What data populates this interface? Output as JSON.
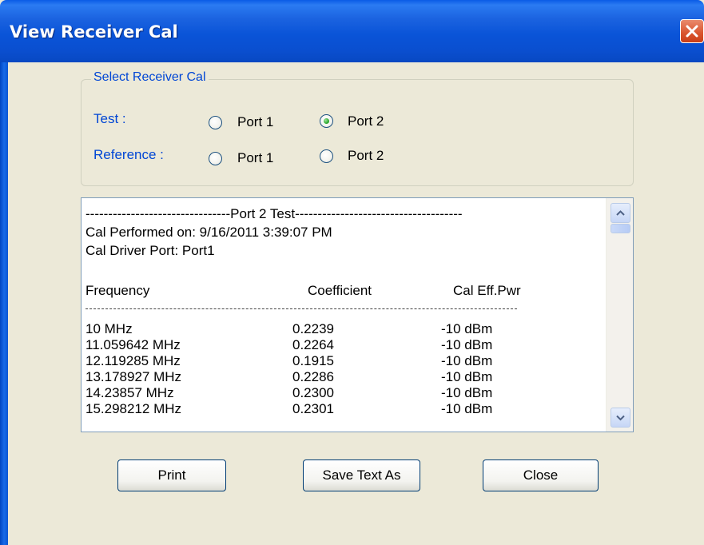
{
  "window": {
    "title": "View Receiver Cal",
    "close_icon": "close-icon"
  },
  "group": {
    "legend": "Select Receiver Cal",
    "test_label": "Test :",
    "reference_label": "Reference :",
    "test_options": [
      {
        "label": "Port 1",
        "checked": false
      },
      {
        "label": "Port 2",
        "checked": true
      }
    ],
    "reference_options": [
      {
        "label": "Port 1",
        "checked": false
      },
      {
        "label": "Port 2",
        "checked": false
      }
    ]
  },
  "report": {
    "header_line": "--------------------------------Port 2 Test-------------------------------------",
    "performed": "Cal Performed on: 9/16/2011 3:39:07 PM",
    "driver_port": "Cal Driver Port: Port1",
    "columns": [
      "Frequency",
      "Coefficient",
      "Cal Eff.Pwr"
    ],
    "rows": [
      [
        "10 MHz",
        "0.2239",
        "-10  dBm"
      ],
      [
        "11.059642 MHz",
        "0.2264",
        "-10  dBm"
      ],
      [
        "12.119285 MHz",
        "0.1915",
        "-10  dBm"
      ],
      [
        "13.178927 MHz",
        "0.2286",
        "-10  dBm"
      ],
      [
        "14.23857 MHz",
        "0.2300",
        "-10  dBm"
      ],
      [
        "15.298212 MHz",
        "0.2301",
        "-10  dBm"
      ]
    ]
  },
  "buttons": {
    "print": "Print",
    "save": "Save Text As",
    "close": "Close"
  },
  "colors": {
    "titlebar": "#0a54d8",
    "label_blue": "#0046d5",
    "dialog_bg": "#ece9d8"
  }
}
